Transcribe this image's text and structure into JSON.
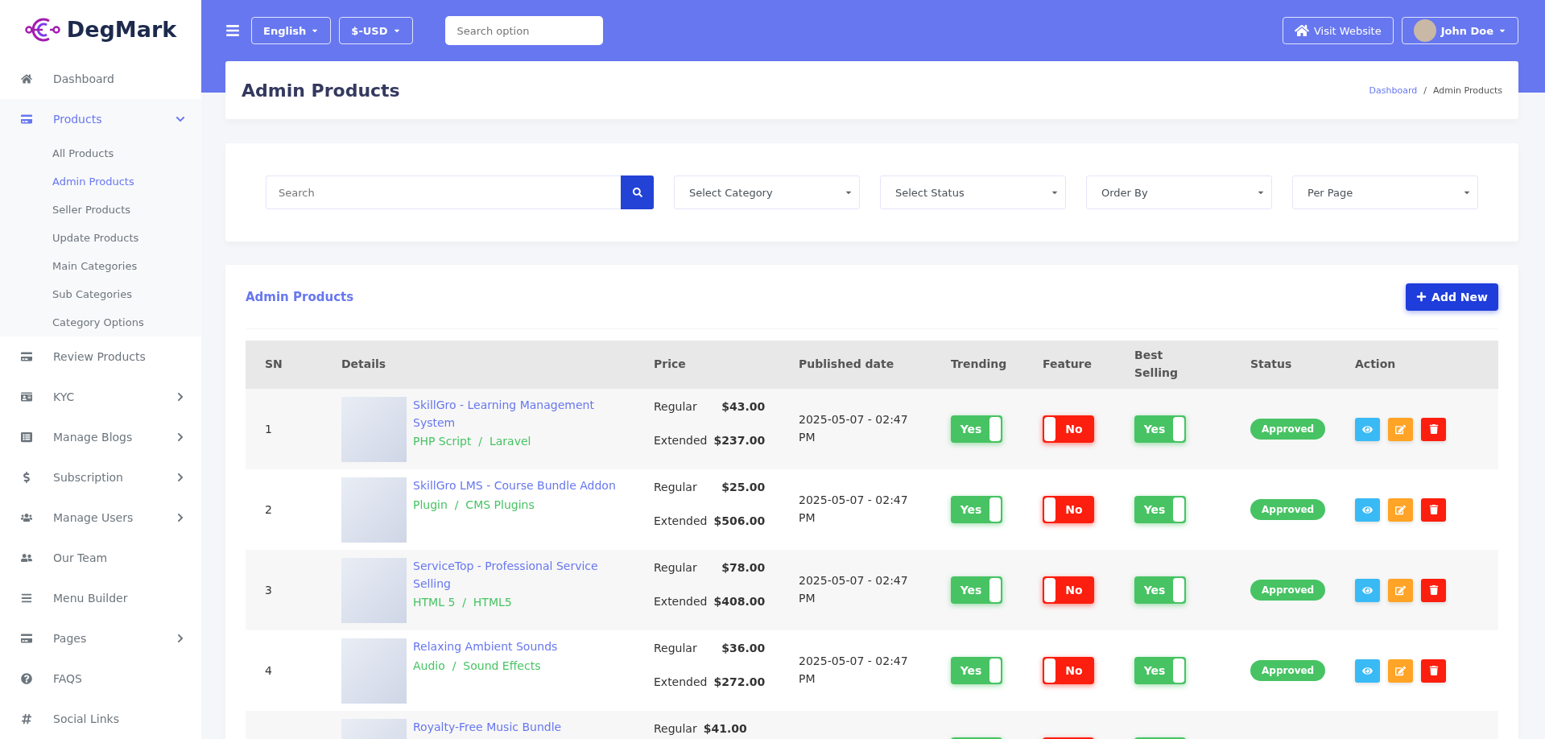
{
  "brand": {
    "name": "DegMark"
  },
  "sidebar": {
    "items": [
      {
        "label": "Dashboard",
        "selected": false
      },
      {
        "label": "Products",
        "selected": true,
        "expanded": true,
        "children": [
          {
            "label": "All Products",
            "selected": false
          },
          {
            "label": "Admin Products",
            "selected": true
          },
          {
            "label": "Seller Products",
            "selected": false
          },
          {
            "label": "Update Products",
            "selected": false
          },
          {
            "label": "Main Categories",
            "selected": false
          },
          {
            "label": "Sub Categories",
            "selected": false
          },
          {
            "label": "Category Options",
            "selected": false
          }
        ]
      },
      {
        "label": "Review Products",
        "selected": false
      },
      {
        "label": "KYC",
        "selected": false,
        "expanded": false
      },
      {
        "label": "Manage Blogs",
        "selected": false,
        "expanded": false
      },
      {
        "label": "Subscription",
        "selected": false,
        "expanded": false
      },
      {
        "label": "Manage Users",
        "selected": false,
        "expanded": false
      },
      {
        "label": "Our Team",
        "selected": false
      },
      {
        "label": "Menu Builder",
        "selected": false
      },
      {
        "label": "Pages",
        "selected": false,
        "expanded": false
      },
      {
        "label": "FAQS",
        "selected": false
      },
      {
        "label": "Social Links",
        "selected": false
      }
    ]
  },
  "topbar": {
    "language": "English",
    "currency": "$-USD",
    "search": {
      "placeholder": "Search option"
    },
    "visit": "Visit Website",
    "user": "John Doe"
  },
  "page_header": {
    "title": "Admin Products",
    "breadcrumb": [
      "Dashboard",
      "Admin Products"
    ],
    "separator": "/"
  },
  "filters": {
    "search": {
      "placeholder": "Search"
    },
    "selects": [
      "Select Category",
      "Select Status",
      "Order By",
      "Per Page"
    ]
  },
  "table_card": {
    "title": "Admin Products",
    "add_button": "Add New",
    "columns": [
      "SN",
      "Details",
      "Price",
      "Published date",
      "Trending",
      "Feature",
      "Best Selling",
      "Status",
      "Action"
    ],
    "rows": [
      {
        "sn": "1",
        "title": "SkillGro - Learning Management System",
        "category": "PHP Script  /  Laravel",
        "regular_label": "Regular",
        "regular": "$43.00",
        "extended_label": "Extended",
        "extended": "$237.00",
        "date": "2025-05-07 - 02:47 PM",
        "trending": {
          "on": true,
          "label": "Yes"
        },
        "feature": {
          "on": false,
          "label": "No"
        },
        "best_selling": {
          "on": true,
          "label": "Yes"
        },
        "status": "Approved"
      },
      {
        "sn": "2",
        "title": "SkillGro LMS - Course Bundle Addon",
        "category": "Plugin  /  CMS Plugins",
        "regular_label": "Regular",
        "regular": "$25.00",
        "extended_label": "Extended",
        "extended": "$506.00",
        "date": "2025-05-07 - 02:47 PM",
        "trending": {
          "on": true,
          "label": "Yes"
        },
        "feature": {
          "on": false,
          "label": "No"
        },
        "best_selling": {
          "on": true,
          "label": "Yes"
        },
        "status": "Approved"
      },
      {
        "sn": "3",
        "title": "ServiceTop - Professional Service Selling",
        "category": "HTML 5  /  HTML5",
        "regular_label": "Regular",
        "regular": "$78.00",
        "extended_label": "Extended",
        "extended": "$408.00",
        "date": "2025-05-07 - 02:47 PM",
        "trending": {
          "on": true,
          "label": "Yes"
        },
        "feature": {
          "on": false,
          "label": "No"
        },
        "best_selling": {
          "on": true,
          "label": "Yes"
        },
        "status": "Approved"
      },
      {
        "sn": "4",
        "title": "Relaxing Ambient Sounds",
        "category": "Audio  /  Sound Effects",
        "regular_label": "Regular",
        "regular": "$36.00",
        "extended_label": "Extended",
        "extended": "$272.00",
        "date": "2025-05-07 - 02:47 PM",
        "trending": {
          "on": true,
          "label": "Yes"
        },
        "feature": {
          "on": false,
          "label": "No"
        },
        "best_selling": {
          "on": true,
          "label": "Yes"
        },
        "status": "Approved"
      },
      {
        "title": "Royalty-Free Music Bundle",
        "regular_label": "Regular",
        "regular": "$41.00",
        "trending": {
          "on": true
        },
        "feature": {
          "on": false
        },
        "best_selling": {
          "on": true
        }
      }
    ]
  }
}
